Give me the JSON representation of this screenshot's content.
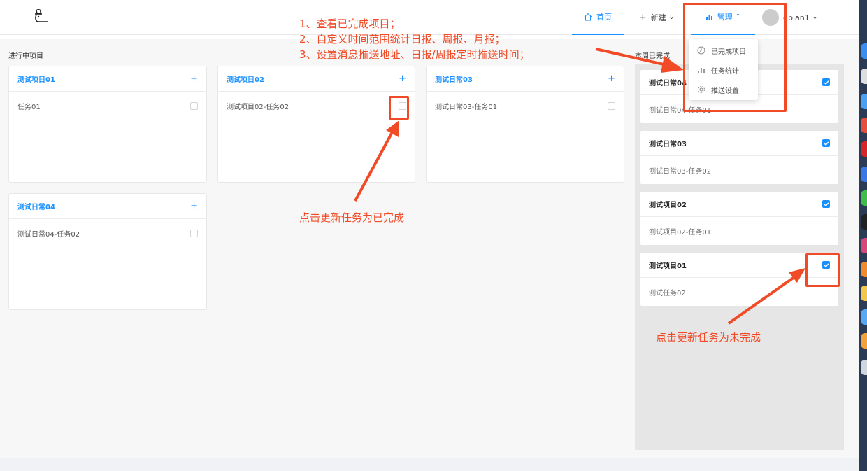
{
  "header": {
    "nav": {
      "home": "首页",
      "new": "新建",
      "manage": "管理",
      "user": "qbian1"
    }
  },
  "dropdown": {
    "items": [
      {
        "label": "已完成项目",
        "icon": "clock-icon"
      },
      {
        "label": "任务统计",
        "icon": "bar-chart-icon"
      },
      {
        "label": "推送设置",
        "icon": "gear-icon"
      }
    ]
  },
  "in_progress": {
    "title": "进行中项目",
    "cards": [
      {
        "title": "测试项目01",
        "tasks": [
          "任务01"
        ]
      },
      {
        "title": "测试项目02",
        "tasks": [
          "测试项目02-任务02"
        ]
      },
      {
        "title": "测试日常03",
        "tasks": [
          "测试日常03-任务01"
        ]
      },
      {
        "title": "测试日常04",
        "tasks": [
          "测试日常04-任务02"
        ]
      }
    ]
  },
  "done_week": {
    "title": "本周已完成",
    "cards": [
      {
        "title": "测试日常04",
        "task": "测试日常04-任务01"
      },
      {
        "title": "测试日常03",
        "task": "测试日常03-任务02"
      },
      {
        "title": "测试项目02",
        "task": "测试项目02-任务01"
      },
      {
        "title": "测试项目01",
        "task": "测试任务02"
      }
    ]
  },
  "annotations": {
    "features": [
      "1、查看已完成项目；",
      "2、自定义时间范围统计日报、周报、月报；",
      "3、设置消息推送地址、日报/周报定时推送时间；"
    ],
    "complete_hint": "点击更新任务为已完成",
    "incomplete_hint": "点击更新任务为未完成"
  },
  "colors": {
    "primary": "#1890ff",
    "annotation": "#f04a26"
  }
}
